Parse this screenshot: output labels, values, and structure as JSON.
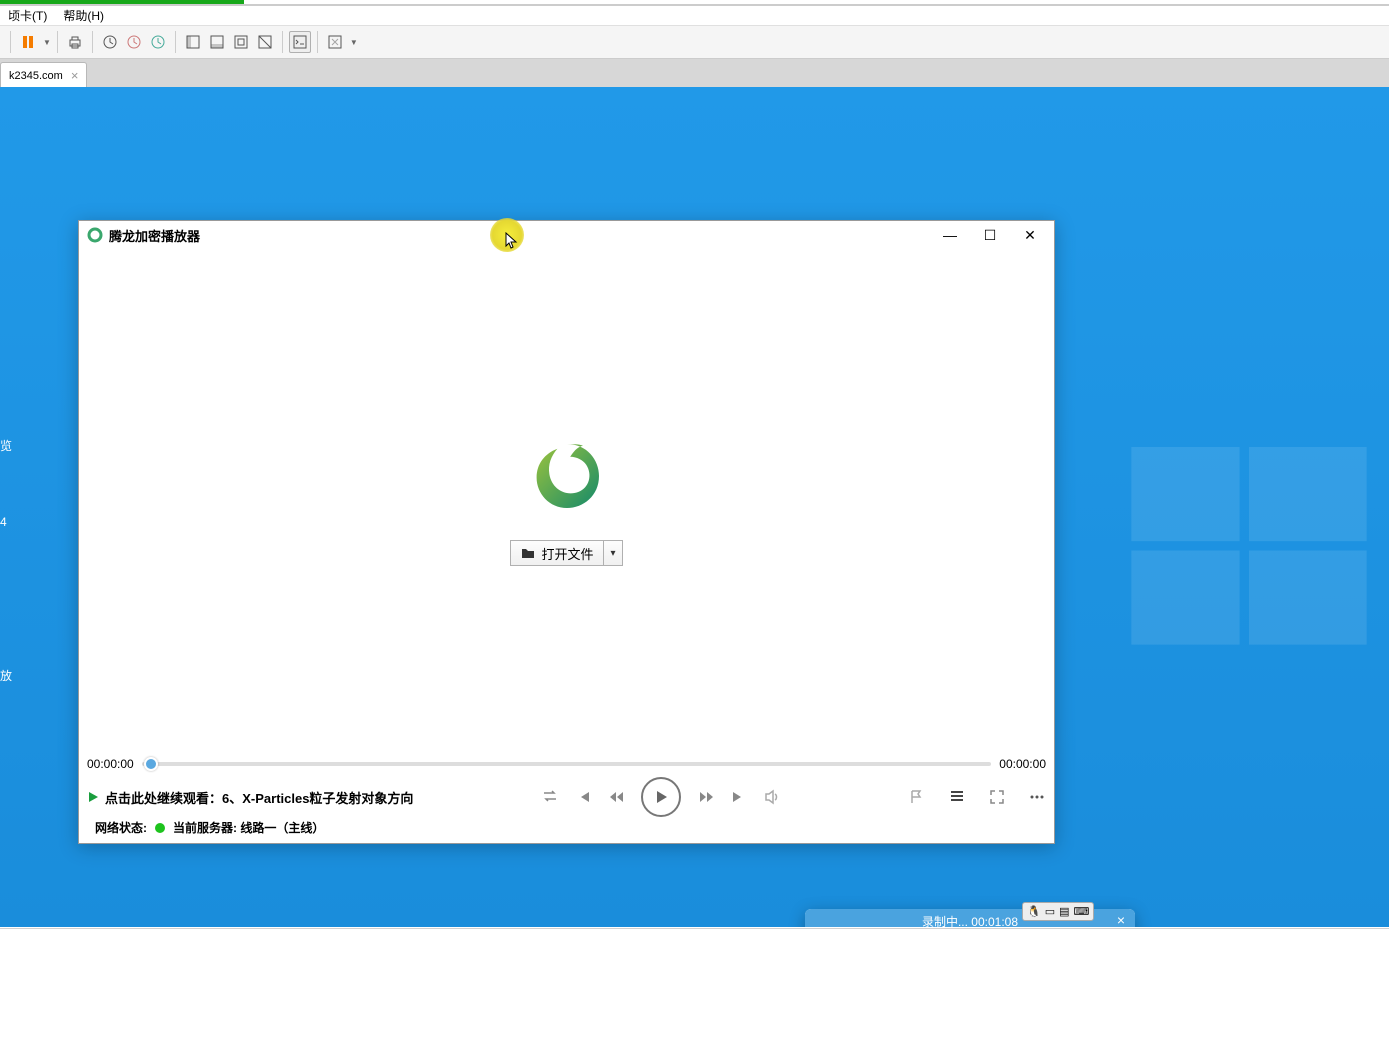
{
  "menubar": {
    "item_card": "顷卡(T)",
    "item_help": "帮助(H)"
  },
  "tab": {
    "label": "k2345.com"
  },
  "player": {
    "title": "腾龙加密播放器",
    "open_file_label": "打开文件",
    "time_current": "00:00:00",
    "time_total": "00:00:00",
    "continue_label": "点击此处继续观看：6、X-Particles粒子发射对象方向",
    "network_status_label": "网络状态:",
    "server_label": "当前服务器: 线路一（主线）"
  },
  "recorder": {
    "status_text": "录制中... 00:01:08"
  },
  "desktop_icons": {
    "icon1": "览",
    "icon2": "4",
    "icon3": "放"
  }
}
